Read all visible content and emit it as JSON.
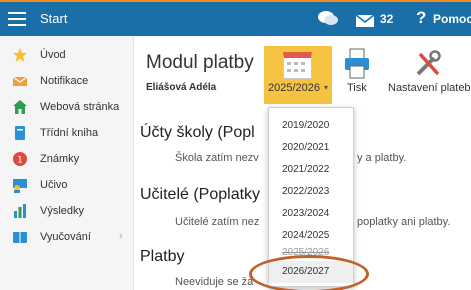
{
  "topbar": {
    "title": "Start",
    "mail_count": "32",
    "help_glyph": "?",
    "help_label": "Pomoc"
  },
  "sidebar": {
    "items": [
      {
        "label": "Úvod",
        "icon": "star-icon",
        "color": "#f6c12d"
      },
      {
        "label": "Notifikace",
        "icon": "envelope-icon",
        "color": "#f0a03a"
      },
      {
        "label": "Webová stránka",
        "icon": "house-icon",
        "color": "#2e9c55"
      },
      {
        "label": "Třídní kniha",
        "icon": "book-icon",
        "color": "#2a8fd3"
      },
      {
        "label": "Známky",
        "icon": "grade-icon",
        "color": "#e0473d"
      },
      {
        "label": "Učivo",
        "icon": "teacher-icon",
        "color": "#2a8fd3"
      },
      {
        "label": "Výsledky",
        "icon": "bar-chart-icon",
        "color": "#2a8fd3"
      },
      {
        "label": "Vyučování",
        "icon": "books-icon",
        "color": "#2a8fd3"
      }
    ]
  },
  "module": {
    "title": "Modul platby",
    "user": "Eliášová Adéla",
    "year_label": "2025/2026",
    "print_label": "Tisk",
    "settings_label": "Nastavení plateb"
  },
  "content": {
    "sections": [
      {
        "title": "Účty školy (Popl",
        "text_left": "Škola zatím nezv",
        "text_right": "y a platby."
      },
      {
        "title": "Učitelé (Poplatky",
        "text_left": "Učitelé zatím nez",
        "text_right": "poplatky ani platby."
      },
      {
        "title": "Platby",
        "text_left": "Neeviduje se žá",
        "text_right": ""
      }
    ]
  },
  "year_dropdown": {
    "options": [
      "2019/2020",
      "2020/2021",
      "2021/2022",
      "2022/2023",
      "2023/2024",
      "2024/2025",
      "2025/2026",
      "2026/2027"
    ],
    "highlighted": "2026/2027",
    "struck": "2025/2026"
  },
  "colors": {
    "topbar": "#1a6fa8",
    "accent_orange": "#f28c1c",
    "year_button": "#f5c242",
    "annotation_circle": "#c0602a"
  }
}
